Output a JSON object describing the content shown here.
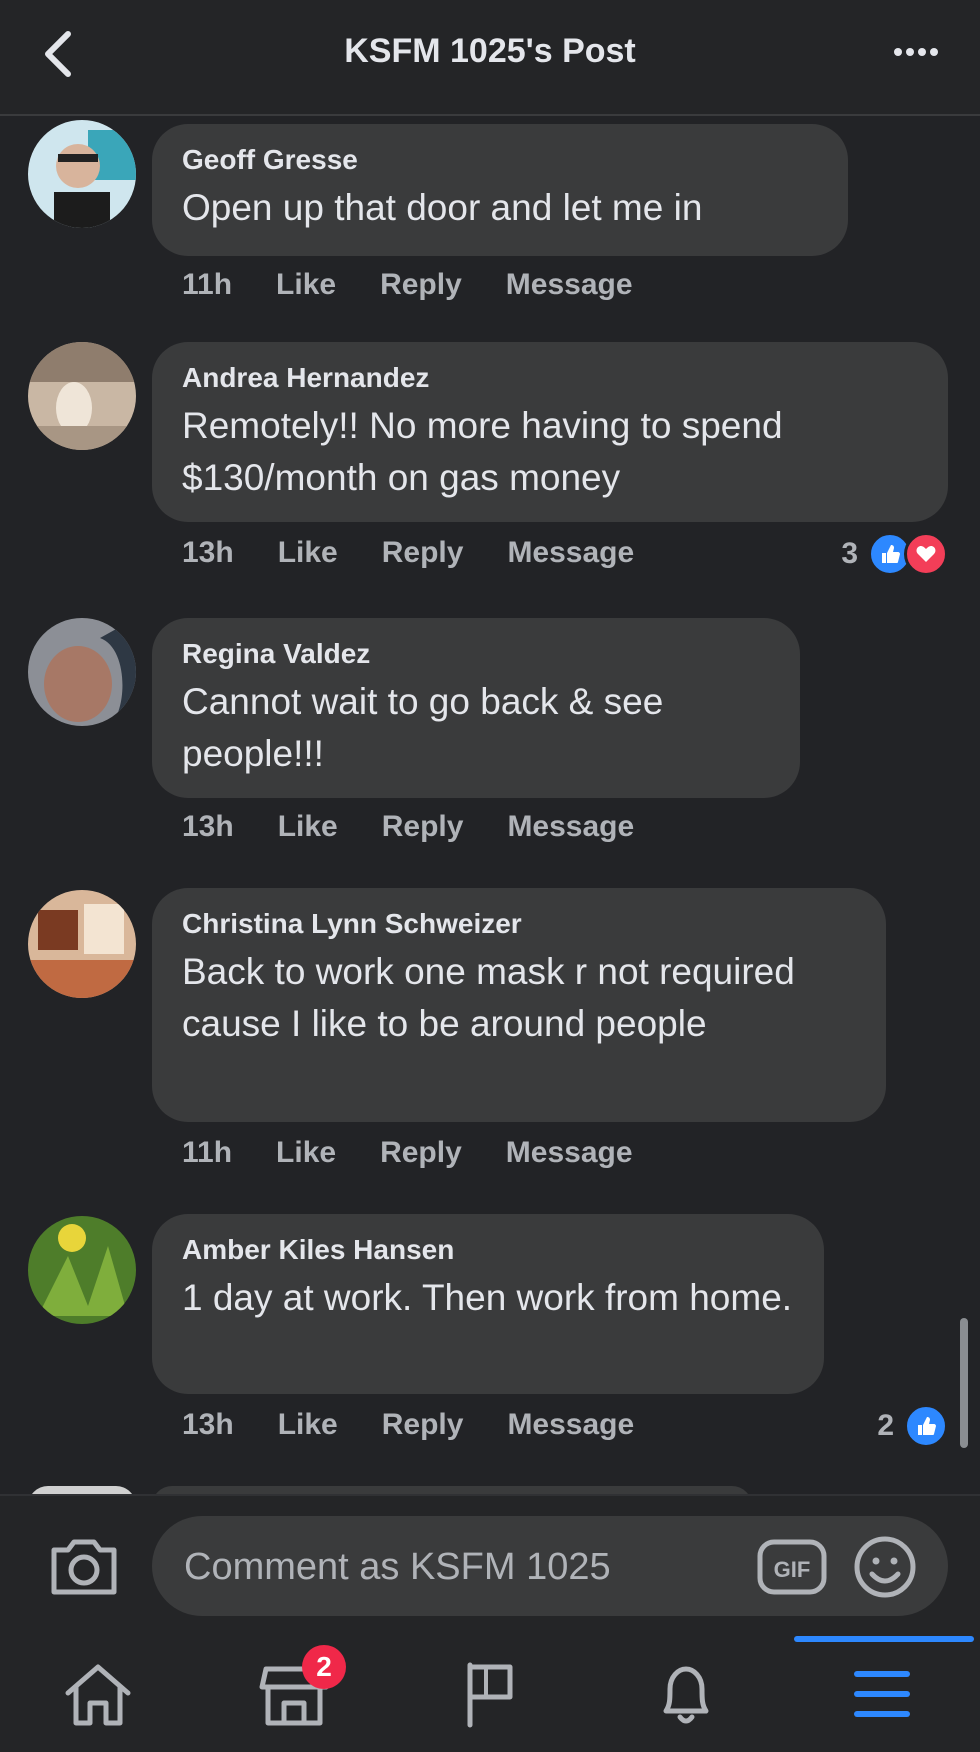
{
  "header": {
    "title": "KSFM 1025's Post"
  },
  "comments": [
    {
      "author": "Geoff Gresse",
      "text": "Open up that door and let me in",
      "time": "11h",
      "like": "Like",
      "reply": "Reply",
      "message": "Message"
    },
    {
      "author": "Andrea Hernandez",
      "text": "Remotely!! No more having to spend $130/month on gas money",
      "time": "13h",
      "like": "Like",
      "reply": "Reply",
      "message": "Message",
      "reaction_count": "3"
    },
    {
      "author": "Regina Valdez",
      "text": "Cannot wait to go back & see people!!!",
      "time": "13h",
      "like": "Like",
      "reply": "Reply",
      "message": "Message"
    },
    {
      "author": "Christina Lynn Schweizer",
      "text": "Back to work one mask r not required cause I like to be around people",
      "time": "11h",
      "like": "Like",
      "reply": "Reply",
      "message": "Message"
    },
    {
      "author": "Amber Kiles Hansen",
      "text": "1 day at work. Then work from home.",
      "time": "13h",
      "like": "Like",
      "reply": "Reply",
      "message": "Message",
      "reaction_count": "2"
    }
  ],
  "composer": {
    "placeholder": "Comment as KSFM 1025",
    "gif_label": "GIF"
  },
  "nav": {
    "marketplace_badge": "2"
  },
  "colors": {
    "background": "#222326",
    "bubble": "#3a3b3c",
    "accent": "#2d88ff",
    "love": "#f33e58",
    "badge": "#f02849"
  },
  "icons": [
    "back-icon",
    "more-icon",
    "camera-icon",
    "gif-icon",
    "emoji-icon",
    "home-icon",
    "marketplace-icon",
    "flag-icon",
    "bell-icon",
    "menu-icon",
    "like-reaction-icon",
    "love-reaction-icon"
  ]
}
